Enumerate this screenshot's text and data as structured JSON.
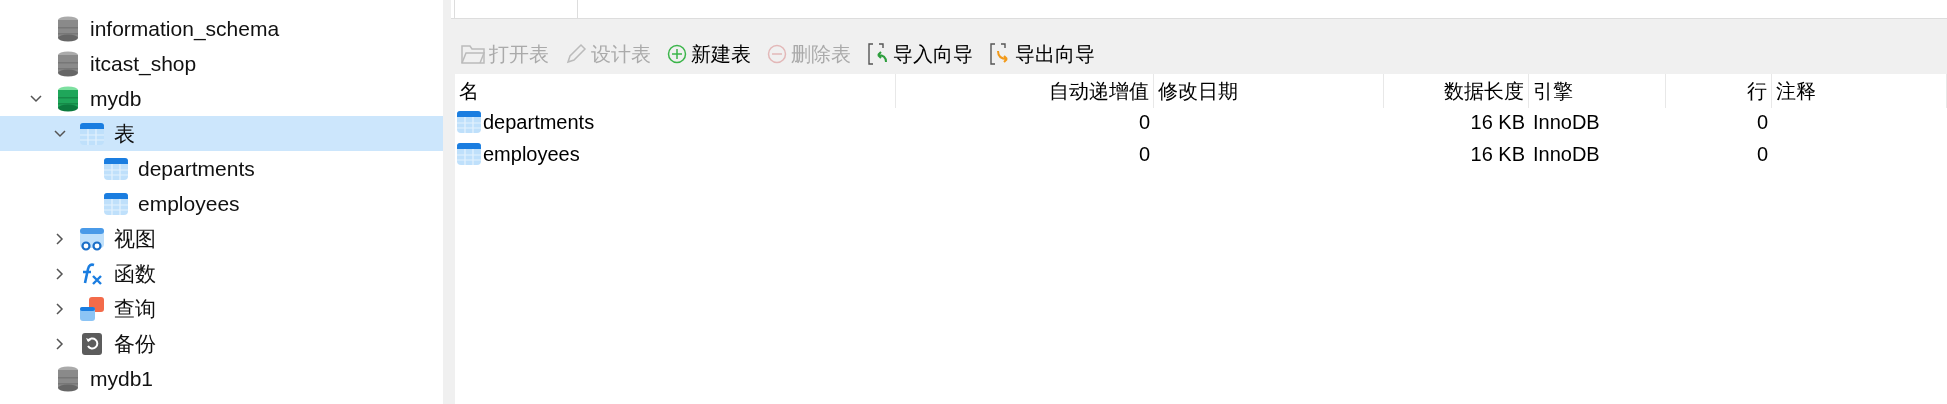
{
  "sidebar": {
    "items": [
      {
        "label": "information_schema",
        "kind": "database",
        "open": false,
        "selected": false
      },
      {
        "label": "itcast_shop",
        "kind": "database",
        "open": false,
        "selected": false
      },
      {
        "label": "mydb",
        "kind": "database",
        "open": true,
        "selected": false,
        "expanded": true,
        "children": [
          {
            "label": "表",
            "kind": "tables",
            "selected": true,
            "expanded": true,
            "children": [
              {
                "label": "departments",
                "kind": "table",
                "selected": false
              },
              {
                "label": "employees",
                "kind": "table",
                "selected": false
              }
            ]
          },
          {
            "label": "视图",
            "kind": "views",
            "selected": false,
            "expanded": false
          },
          {
            "label": "函数",
            "kind": "functions",
            "selected": false,
            "expanded": false
          },
          {
            "label": "查询",
            "kind": "queries",
            "selected": false,
            "expanded": false
          },
          {
            "label": "备份",
            "kind": "backups",
            "selected": false,
            "expanded": false
          }
        ]
      },
      {
        "label": "mydb1",
        "kind": "database",
        "open": false,
        "selected": false
      }
    ]
  },
  "toolbar": [
    {
      "label": "打开表",
      "kind": "open",
      "disabled": true
    },
    {
      "label": "设计表",
      "kind": "design",
      "disabled": true
    },
    {
      "label": "新建表",
      "kind": "new",
      "disabled": false
    },
    {
      "label": "删除表",
      "kind": "delete",
      "disabled": true
    },
    {
      "label": "导入向导",
      "kind": "import",
      "disabled": false
    },
    {
      "label": "导出向导",
      "kind": "export",
      "disabled": false
    }
  ],
  "table": {
    "columns": [
      "名",
      "自动递增值",
      "修改日期",
      "数据长度",
      "引擎",
      "行",
      "注释"
    ],
    "rows": [
      [
        "departments",
        "0",
        "",
        "16 KB",
        "InnoDB",
        "0",
        ""
      ],
      [
        "employees",
        "0",
        "",
        "16 KB",
        "InnoDB",
        "0",
        ""
      ]
    ]
  }
}
